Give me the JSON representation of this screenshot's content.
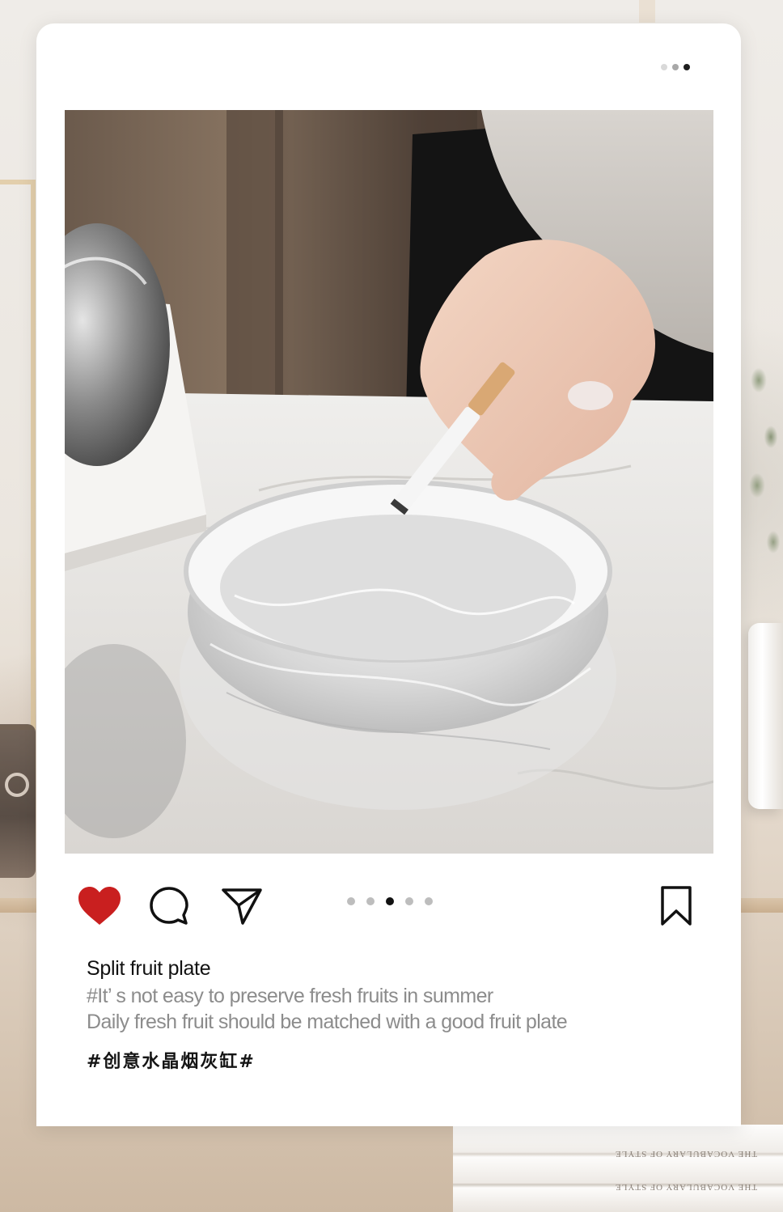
{
  "post": {
    "caption_title": "Split fruit plate",
    "caption_lines": [
      "#It’ s not easy to preserve fresh fruits in summer",
      "Daily fresh fruit should be matched with a good fruit plate"
    ],
    "hashtag": "#创意水晶烟灰缸#",
    "carousel": {
      "total": 5,
      "active_index": 2
    }
  },
  "top_indicator": {
    "total": 3,
    "active_index": 2
  },
  "icons": {
    "like": "heart-icon",
    "comment": "comment-icon",
    "share": "send-icon",
    "save": "bookmark-icon"
  },
  "colors": {
    "heart": "#c91f1f",
    "active_dot": "#111111",
    "inactive_dot": "#bdbdbd",
    "caption_secondary": "#8c8c8c"
  },
  "background": {
    "book_spine_text": "THE VOCABULARY OF STYLE"
  }
}
